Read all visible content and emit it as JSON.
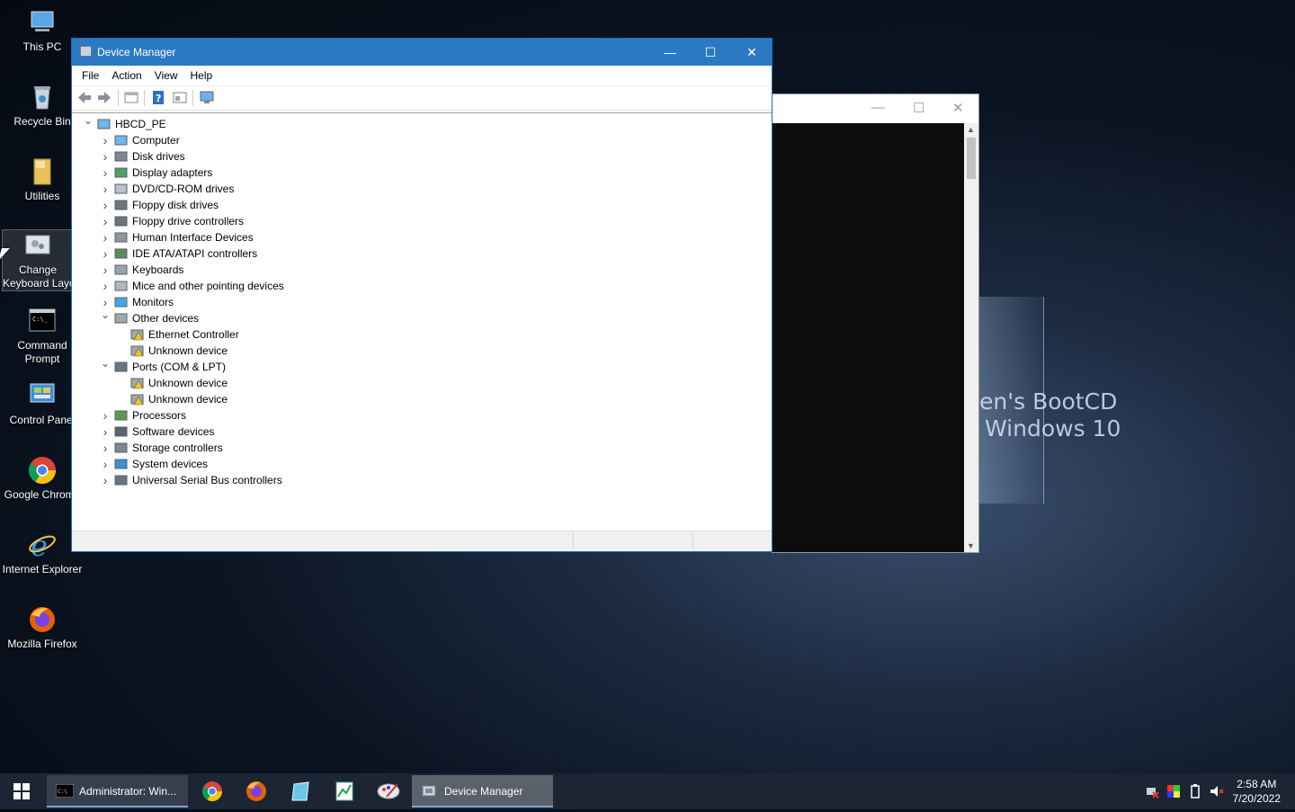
{
  "desktop": {
    "icons": [
      {
        "label": "This PC",
        "icon": "computer-icon"
      },
      {
        "label": "Recycle Bin",
        "icon": "recycle-bin-icon"
      },
      {
        "label": "Utilities",
        "icon": "folder-icon"
      },
      {
        "label": "Change Keyboard Layo",
        "icon": "keyboard-layout-icon"
      },
      {
        "label": "Command Prompt",
        "icon": "command-prompt-icon"
      },
      {
        "label": "Control Panel",
        "icon": "control-panel-icon"
      },
      {
        "label": "Google Chrome",
        "icon": "chrome-icon"
      },
      {
        "label": "Internet Explorer",
        "icon": "internet-explorer-icon"
      },
      {
        "label": "Mozilla Firefox",
        "icon": "firefox-icon"
      }
    ],
    "icon_label_lines": {
      "change_keyboard_1": "Change",
      "change_keyboard_2": "Keyboard Layo",
      "command_prompt_1": "Command",
      "command_prompt_2": "Prompt"
    },
    "wallpaper_text": {
      "line1": "en's BootCD",
      "line2": "Windows 10"
    }
  },
  "device_manager": {
    "title": "Device Manager",
    "menu": [
      "File",
      "Action",
      "View",
      "Help"
    ],
    "tree": {
      "root": "HBCD_PE",
      "categories": [
        {
          "label": "Computer",
          "expanded": false,
          "icon": "computer-icon"
        },
        {
          "label": "Disk drives",
          "expanded": false,
          "icon": "disk-drive-icon"
        },
        {
          "label": "Display adapters",
          "expanded": false,
          "icon": "display-adapter-icon"
        },
        {
          "label": "DVD/CD-ROM drives",
          "expanded": false,
          "icon": "dvd-drive-icon"
        },
        {
          "label": "Floppy disk drives",
          "expanded": false,
          "icon": "floppy-disk-icon"
        },
        {
          "label": "Floppy drive controllers",
          "expanded": false,
          "icon": "floppy-controller-icon"
        },
        {
          "label": "Human Interface Devices",
          "expanded": false,
          "icon": "hid-icon"
        },
        {
          "label": "IDE ATA/ATAPI controllers",
          "expanded": false,
          "icon": "ide-controller-icon"
        },
        {
          "label": "Keyboards",
          "expanded": false,
          "icon": "keyboard-icon"
        },
        {
          "label": "Mice and other pointing devices",
          "expanded": false,
          "icon": "mouse-icon"
        },
        {
          "label": "Monitors",
          "expanded": false,
          "icon": "monitor-icon"
        },
        {
          "label": "Other devices",
          "expanded": true,
          "icon": "unknown-device-icon",
          "children": [
            "Ethernet Controller",
            "Unknown device"
          ]
        },
        {
          "label": "Ports (COM & LPT)",
          "expanded": true,
          "icon": "port-icon",
          "children": [
            "Unknown device",
            "Unknown device"
          ]
        },
        {
          "label": "Processors",
          "expanded": false,
          "icon": "processor-icon"
        },
        {
          "label": "Software devices",
          "expanded": false,
          "icon": "software-device-icon"
        },
        {
          "label": "Storage controllers",
          "expanded": false,
          "icon": "storage-controller-icon"
        },
        {
          "label": "System devices",
          "expanded": false,
          "icon": "system-device-icon"
        },
        {
          "label": "Universal Serial Bus controllers",
          "expanded": false,
          "icon": "usb-icon"
        }
      ]
    }
  },
  "taskbar": {
    "apps": [
      {
        "label": "Administrator: Win...",
        "active": false
      },
      {
        "label": "Device Manager",
        "active": true
      }
    ],
    "clock": {
      "time": "2:58 AM",
      "date": "7/20/2022"
    }
  },
  "colors": {
    "titlebar": "#2b79c2",
    "taskbar": "#1b2533",
    "console": "#0c0c0c"
  }
}
